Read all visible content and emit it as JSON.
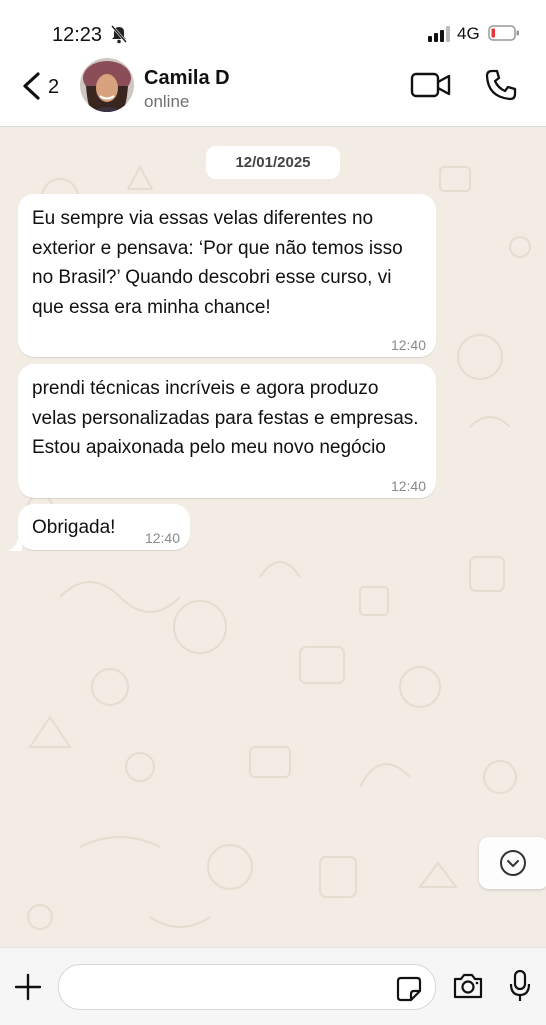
{
  "status_bar": {
    "time": "12:23",
    "network": "4G",
    "icons": [
      "bell-off-icon",
      "signal-icon",
      "battery-low-icon"
    ]
  },
  "header": {
    "back_count": "2",
    "contact_name": "Camila D",
    "contact_status": "online",
    "icons": [
      "chevron-left-icon",
      "video-call-icon",
      "phone-icon"
    ]
  },
  "chat": {
    "date_label": "12/01/2025",
    "messages": [
      {
        "text": "Eu sempre via essas velas diferentes no exterior e pensava: ‘Por que não temos isso no Brasil?’ Quando descobri esse curso, vi que essa era minha chance!",
        "time": "12:40"
      },
      {
        "text": "prendi técnicas incríveis e agora produzo velas personalizadas para festas e empresas. Estou apaixonada pelo meu novo negócio",
        "time": "12:40"
      },
      {
        "text": "Obrigada!",
        "time": "12:40"
      }
    ]
  },
  "input_bar": {
    "placeholder": "",
    "icons": [
      "plus-icon",
      "sticker-icon",
      "camera-icon",
      "microphone-icon"
    ]
  },
  "colors": {
    "chat_background": "#f3ece4",
    "bubble": "#ffffff",
    "header": "#ffffff",
    "battery_low": "#e53935"
  }
}
